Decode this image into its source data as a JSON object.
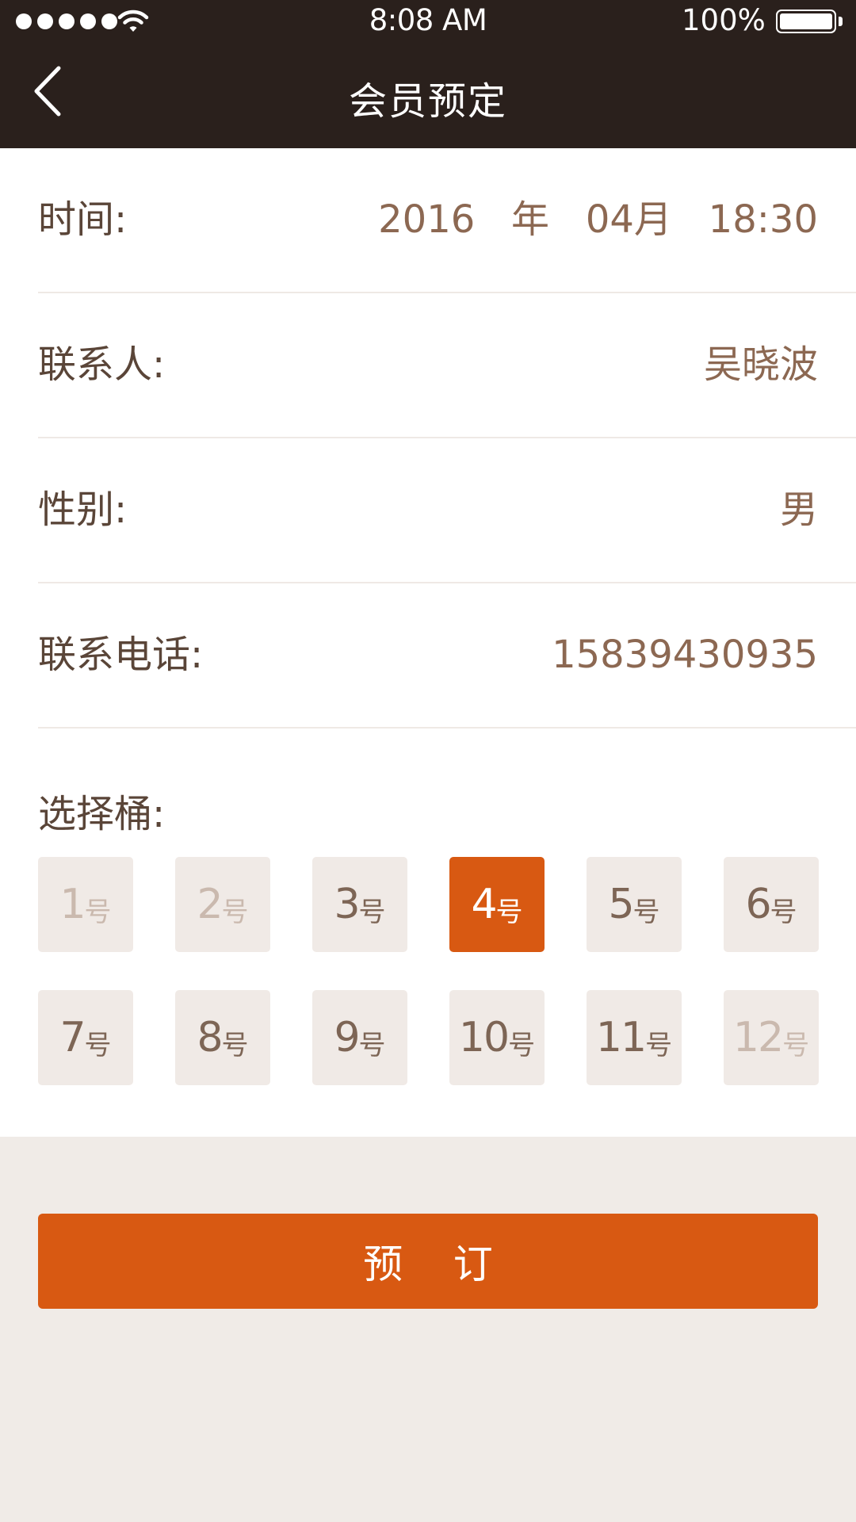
{
  "status_bar": {
    "time": "8:08 AM",
    "battery": "100%",
    "signal_icon": "signal-dots-icon",
    "wifi_icon": "wifi-icon",
    "battery_icon": "battery-icon"
  },
  "nav": {
    "title": "会员预定",
    "back_icon": "back-arrow-icon"
  },
  "form": {
    "time": {
      "label": "时间:",
      "value": "2016   年   04月   18:30"
    },
    "contact": {
      "label": "联系人:",
      "value": "吴晓波"
    },
    "gender": {
      "label": "性别:",
      "value": "男"
    },
    "phone": {
      "label": "联系电话:",
      "value": "15839430935"
    }
  },
  "buckets": {
    "title": "选择桶:",
    "unit": "号",
    "items": [
      {
        "number": "1",
        "state": "disabled"
      },
      {
        "number": "2",
        "state": "disabled"
      },
      {
        "number": "3",
        "state": "available"
      },
      {
        "number": "4",
        "state": "selected"
      },
      {
        "number": "5",
        "state": "available"
      },
      {
        "number": "6",
        "state": "available"
      },
      {
        "number": "7",
        "state": "available"
      },
      {
        "number": "8",
        "state": "available"
      },
      {
        "number": "9",
        "state": "available"
      },
      {
        "number": "10",
        "state": "available"
      },
      {
        "number": "11",
        "state": "available"
      },
      {
        "number": "12",
        "state": "disabled"
      }
    ]
  },
  "submit_label": "预    订",
  "colors": {
    "header_bg": "#2a201c",
    "accent": "#d85912",
    "label_text": "#5a4538",
    "value_text": "#8c6852",
    "bucket_bg": "#f0eae6",
    "page_bg": "#f0ebe7"
  }
}
